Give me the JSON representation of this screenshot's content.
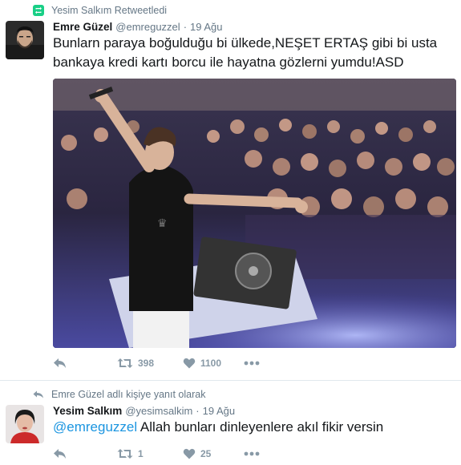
{
  "tweet1": {
    "context": "Yesim Salkım Retweetledi",
    "fullname": "Emre Güzel",
    "handle": "@emreguzzel",
    "separator": "·",
    "time": "19 Ağu",
    "text": "Bunlarn paraya boğulduğu bi ülkede,NEŞET ERTAŞ gibi bi usta bankaya kredi kartı borcu ile hayatna gözlerni yumdu!ASD",
    "retweets": "398",
    "likes": "1100"
  },
  "tweet2": {
    "context": "Emre Güzel adlı kişiye yanıt olarak",
    "fullname": "Yesim Salkım",
    "handle": "@yesimsalkim",
    "separator": "·",
    "time": "19 Ağu",
    "mention": "@emreguzzel",
    "text": " Allah bunları dinleyenlere akıl fikir versin",
    "retweets": "1",
    "likes": "25"
  },
  "colors": {
    "retweet_green": "#19cf86",
    "link_blue": "#1b95e0",
    "muted_gray": "#657786",
    "action_gray": "#8899a6"
  },
  "icons": {
    "context1": "retweet-badge-icon",
    "context2": "reply-arrow-icon",
    "actions": [
      "reply-icon",
      "retweet-icon",
      "like-heart-icon",
      "more-dots-icon"
    ]
  }
}
